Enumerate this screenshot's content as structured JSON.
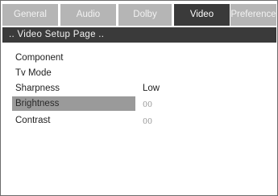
{
  "tabs": [
    {
      "label": "General",
      "active": false
    },
    {
      "label": "Audio",
      "active": false
    },
    {
      "label": "Dolby",
      "active": false
    },
    {
      "label": "Video",
      "active": true
    },
    {
      "label": "Preference",
      "active": false
    }
  ],
  "page_title": ".. Video Setup Page ..",
  "settings": [
    {
      "label": "Component",
      "value": ""
    },
    {
      "label": "Tv Mode",
      "value": ""
    },
    {
      "label": "Sharpness",
      "value": "Low"
    },
    {
      "label": "Brightness",
      "value": "00",
      "selected": true
    },
    {
      "label": "Contrast",
      "value": "00"
    }
  ],
  "colors": {
    "tab_inactive": "#b5b5b5",
    "tab_active": "#3a3a3a",
    "title_bar": "#3a3a3a",
    "selection": "#9a9a9a"
  }
}
